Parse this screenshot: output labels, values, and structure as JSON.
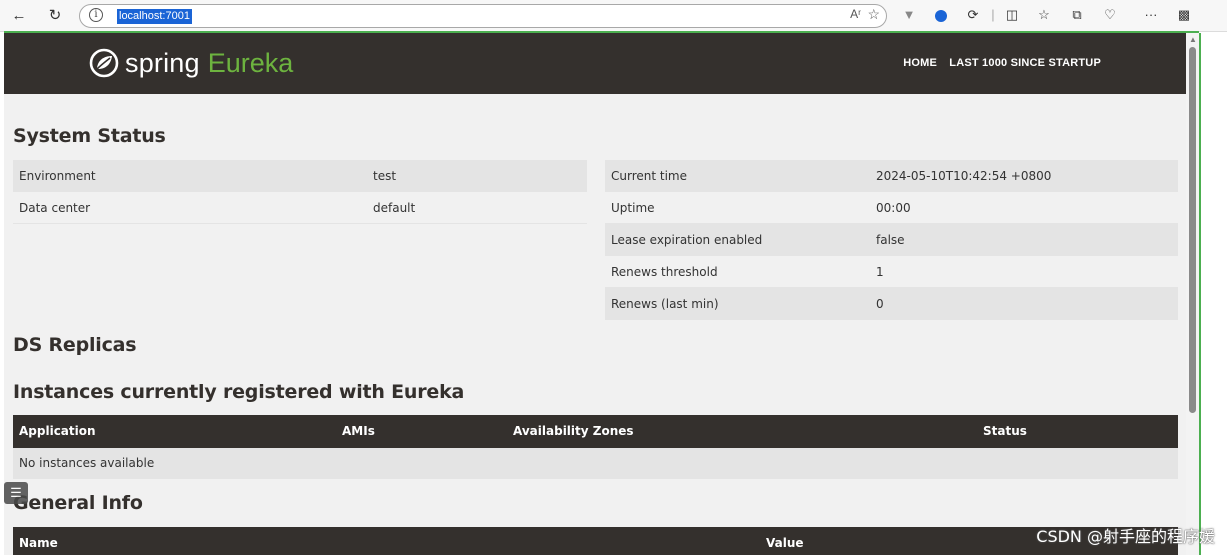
{
  "browser": {
    "url": "localhost:7001",
    "read_aloud_label": "Aʳ",
    "back_icon": "arrow-left-icon",
    "refresh_icon": "refresh-icon",
    "more_label": "···"
  },
  "nav": {
    "brand_spring": "spring",
    "brand_eureka": "Eureka",
    "links": [
      "HOME",
      "LAST 1000 SINCE STARTUP"
    ]
  },
  "system_status": {
    "title": "System Status",
    "left": [
      {
        "key": "Environment",
        "value": "test"
      },
      {
        "key": "Data center",
        "value": "default"
      }
    ],
    "right": [
      {
        "key": "Current time",
        "value": "2024-05-10T10:42:54 +0800"
      },
      {
        "key": "Uptime",
        "value": "00:00"
      },
      {
        "key": "Lease expiration enabled",
        "value": "false"
      },
      {
        "key": "Renews threshold",
        "value": "1"
      },
      {
        "key": "Renews (last min)",
        "value": "0"
      }
    ]
  },
  "ds_replicas": {
    "title": "DS Replicas"
  },
  "instances": {
    "title": "Instances currently registered with Eureka",
    "columns": [
      "Application",
      "AMIs",
      "Availability Zones",
      "Status"
    ],
    "empty": "No instances available"
  },
  "general_info": {
    "title": "General Info",
    "columns": [
      "Name",
      "Value"
    ]
  },
  "watermark": "CSDN @射手座的程序媛",
  "colors": {
    "header_bg": "#34302d",
    "brand_green": "#6db33f",
    "content_bg": "#f1f1f1",
    "row_alt": "#e4e4e4"
  }
}
